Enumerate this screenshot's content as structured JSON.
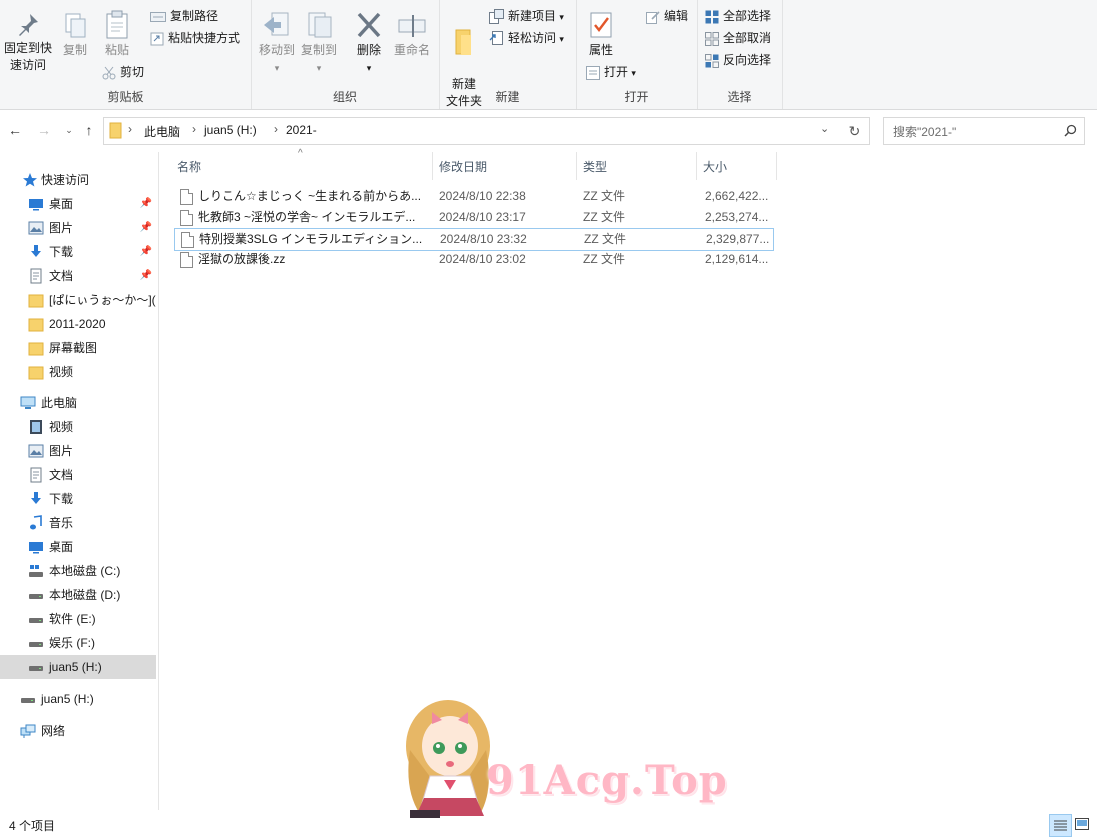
{
  "ribbon": {
    "clipboard": {
      "pin_label": "固定到快速访问",
      "copy_label": "复制",
      "paste_label": "粘贴",
      "copy_path_label": "复制路径",
      "paste_shortcut_label": "粘贴快捷方式",
      "cut_label": "剪切",
      "group_label": "剪贴板"
    },
    "organize": {
      "move_to_label": "移动到",
      "copy_to_label": "复制到",
      "delete_label": "删除",
      "rename_label": "重命名",
      "group_label": "组织"
    },
    "new": {
      "new_folder_label": "新建\n文件夹",
      "new_item_label": "新建项目",
      "easy_access_label": "轻松访问",
      "group_label": "新建"
    },
    "open": {
      "properties_label": "属性",
      "open_label": "打开",
      "edit_label": "编辑",
      "group_label": "打开"
    },
    "select": {
      "select_all_label": "全部选择",
      "select_none_label": "全部取消",
      "invert_label": "反向选择",
      "group_label": "选择"
    }
  },
  "address": {
    "crumbs": [
      "此电脑",
      "juan5 (H:)",
      "2021-"
    ],
    "search_placeholder": "搜索\"2021-\""
  },
  "sidebar": {
    "quick_access": "快速访问",
    "quick_items": [
      {
        "label": "桌面",
        "icon": "desktop-icon",
        "pinned": true
      },
      {
        "label": "图片",
        "icon": "pictures-icon",
        "pinned": true
      },
      {
        "label": "下载",
        "icon": "download-icon",
        "pinned": true
      },
      {
        "label": "文档",
        "icon": "documents-icon",
        "pinned": true
      },
      {
        "label": "[ぱにぃうぉ～か～](",
        "icon": "folder-icon",
        "pinned": false
      },
      {
        "label": "2011-2020",
        "icon": "folder-icon",
        "pinned": false
      },
      {
        "label": "屏幕截图",
        "icon": "folder-icon",
        "pinned": false
      },
      {
        "label": "视频",
        "icon": "folder-icon",
        "pinned": false
      }
    ],
    "this_pc": "此电脑",
    "pc_items": [
      {
        "label": "视频",
        "icon": "videos-icon"
      },
      {
        "label": "图片",
        "icon": "pictures-icon"
      },
      {
        "label": "文档",
        "icon": "documents-icon"
      },
      {
        "label": "下载",
        "icon": "download-icon"
      },
      {
        "label": "音乐",
        "icon": "music-icon"
      },
      {
        "label": "桌面",
        "icon": "desktop-icon"
      },
      {
        "label": "本地磁盘 (C:)",
        "icon": "drive-c-icon"
      },
      {
        "label": "本地磁盘 (D:)",
        "icon": "drive-icon"
      },
      {
        "label": "软件 (E:)",
        "icon": "drive-icon"
      },
      {
        "label": "娱乐 (F:)",
        "icon": "drive-icon"
      },
      {
        "label": "juan5 (H:)",
        "icon": "drive-icon",
        "selected": true
      }
    ],
    "removable": "juan5 (H:)",
    "network": "网络"
  },
  "columns": {
    "name": "名称",
    "modified": "修改日期",
    "type": "类型",
    "size": "大小"
  },
  "files": [
    {
      "name": "しりこん☆まじっく ~生まれる前からあ...",
      "modified": "2024/8/10 22:38",
      "type": "ZZ 文件",
      "size": "2,662,422..."
    },
    {
      "name": "牝教師3 ~淫悦の学舎~ インモラルエデ...",
      "modified": "2024/8/10 23:17",
      "type": "ZZ 文件",
      "size": "2,253,274..."
    },
    {
      "name": "特別授業3SLG インモラルエディション...",
      "modified": "2024/8/10 23:32",
      "type": "ZZ 文件",
      "size": "2,329,877...",
      "selected": true
    },
    {
      "name": "淫獄の放課後.zz",
      "modified": "2024/8/10 23:02",
      "type": "ZZ 文件",
      "size": "2,129,614..."
    }
  ],
  "status": {
    "count": "4 个项目"
  },
  "watermark": "91Acg.Top"
}
